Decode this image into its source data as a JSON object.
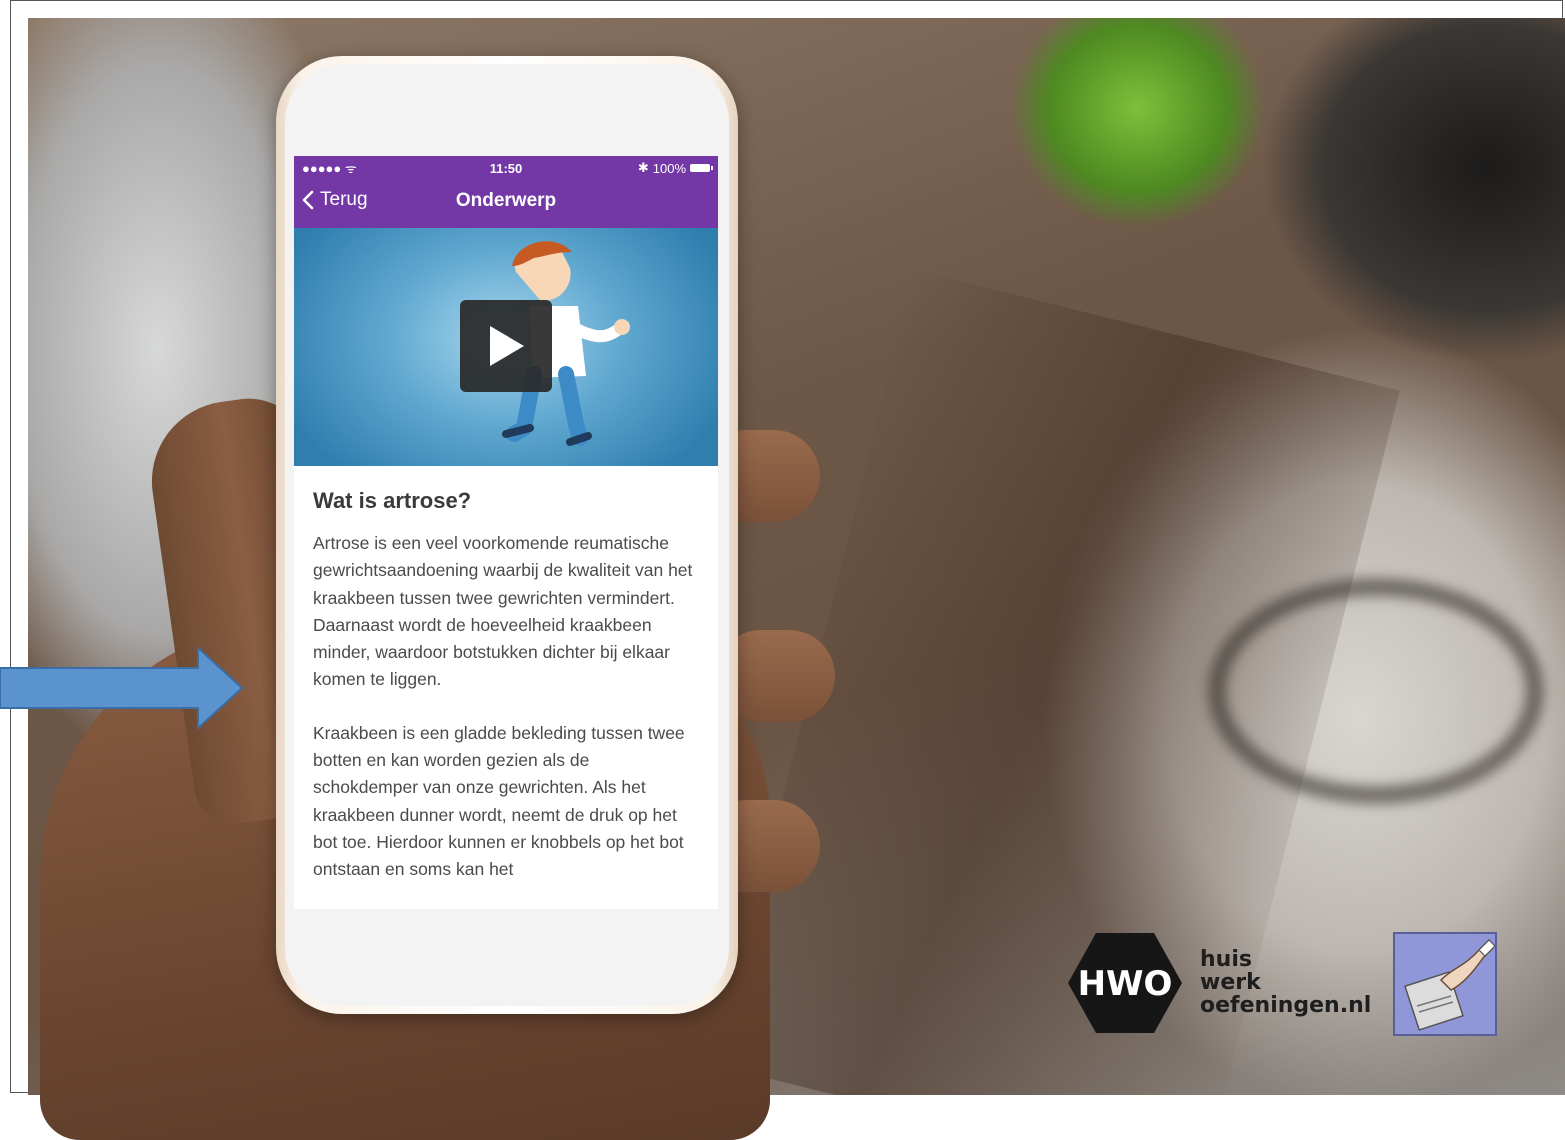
{
  "status_bar": {
    "signal": "●●●●● ᯤ",
    "time": "11:50",
    "bluetooth": "✱",
    "battery": "100%"
  },
  "nav": {
    "back_label": "Terug",
    "title": "Onderwerp"
  },
  "video": {
    "play_icon": "play-icon"
  },
  "article": {
    "heading": "Wat is artrose?",
    "paragraph1": "Artrose is een veel voorkomende reumatische gewrichtsaandoening waarbij de kwaliteit van het kraakbeen tussen twee gewrichten vermindert. Daarnaast wordt de hoeveelheid kraakbeen minder, waardoor botstukken dichter bij elkaar komen te liggen.",
    "paragraph2": "Kraakbeen is een gladde bekleding tussen twee botten en kan worden gezien als de schokdemper van onze gewrichten. Als het kraakbeen dunner wordt, neemt de druk op het bot toe. Hierdoor kunnen er knobbels op het bot ontstaan en soms kan het"
  },
  "branding": {
    "hwo_logo_text": "HWO",
    "line1": "huis",
    "line2": "werk",
    "line3": "oefeningen.nl"
  },
  "colors": {
    "header_purple": "#7438a6",
    "arrow_blue": "#5b93cf"
  }
}
